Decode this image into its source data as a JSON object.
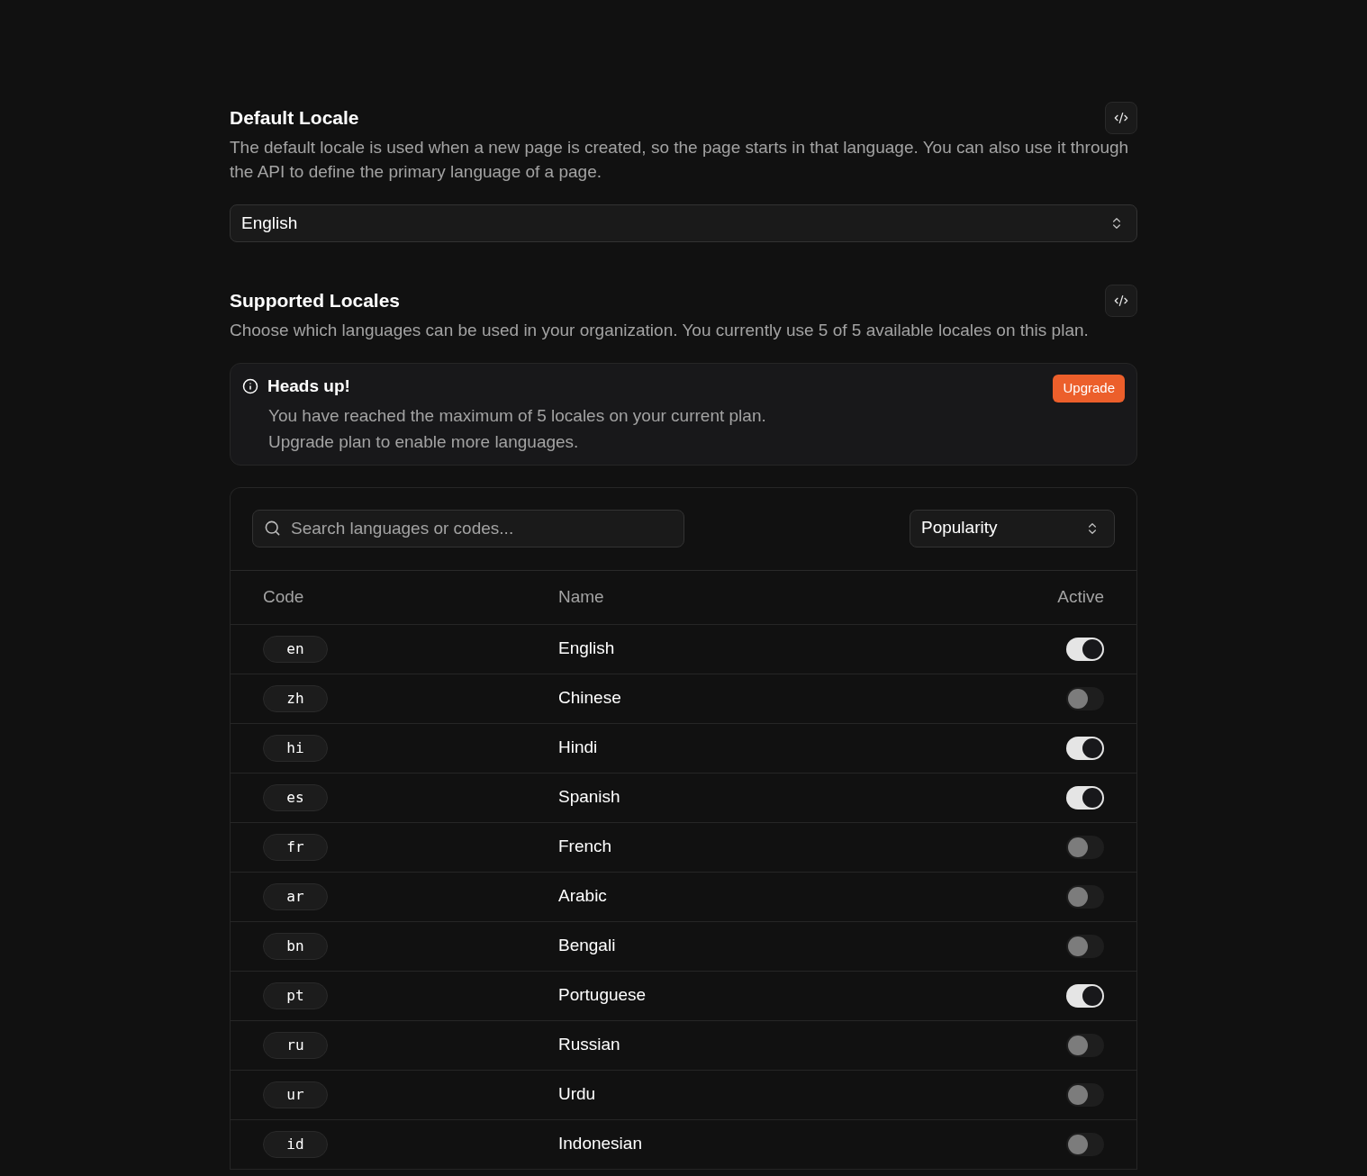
{
  "default_locale": {
    "title": "Default Locale",
    "description": "The default locale is used when a new page is created, so the page starts in that language. You can also use it through the API to define the primary language of a page.",
    "select": {
      "value": "English"
    }
  },
  "supported_locales": {
    "title": "Supported Locales",
    "description": "Choose which languages can be used in your organization. You currently use 5 of 5 available locales on this plan.",
    "alert": {
      "title": "Heads up!",
      "lines": [
        "You have reached the maximum of 5 locales on your current plan.",
        "Upgrade plan to enable more languages."
      ],
      "button": "Upgrade"
    },
    "search": {
      "placeholder": "Search languages or codes..."
    },
    "sort": {
      "value": "Popularity"
    },
    "table": {
      "columns": [
        "Code",
        "Name",
        "Active"
      ],
      "rows": [
        {
          "code": "en",
          "name": "English",
          "active": true
        },
        {
          "code": "zh",
          "name": "Chinese",
          "active": false
        },
        {
          "code": "hi",
          "name": "Hindi",
          "active": true
        },
        {
          "code": "es",
          "name": "Spanish",
          "active": true
        },
        {
          "code": "fr",
          "name": "French",
          "active": false
        },
        {
          "code": "ar",
          "name": "Arabic",
          "active": false
        },
        {
          "code": "bn",
          "name": "Bengali",
          "active": false
        },
        {
          "code": "pt",
          "name": "Portuguese",
          "active": true
        },
        {
          "code": "ru",
          "name": "Russian",
          "active": false
        },
        {
          "code": "ur",
          "name": "Urdu",
          "active": false
        },
        {
          "code": "id",
          "name": "Indonesian",
          "active": false
        }
      ]
    }
  }
}
